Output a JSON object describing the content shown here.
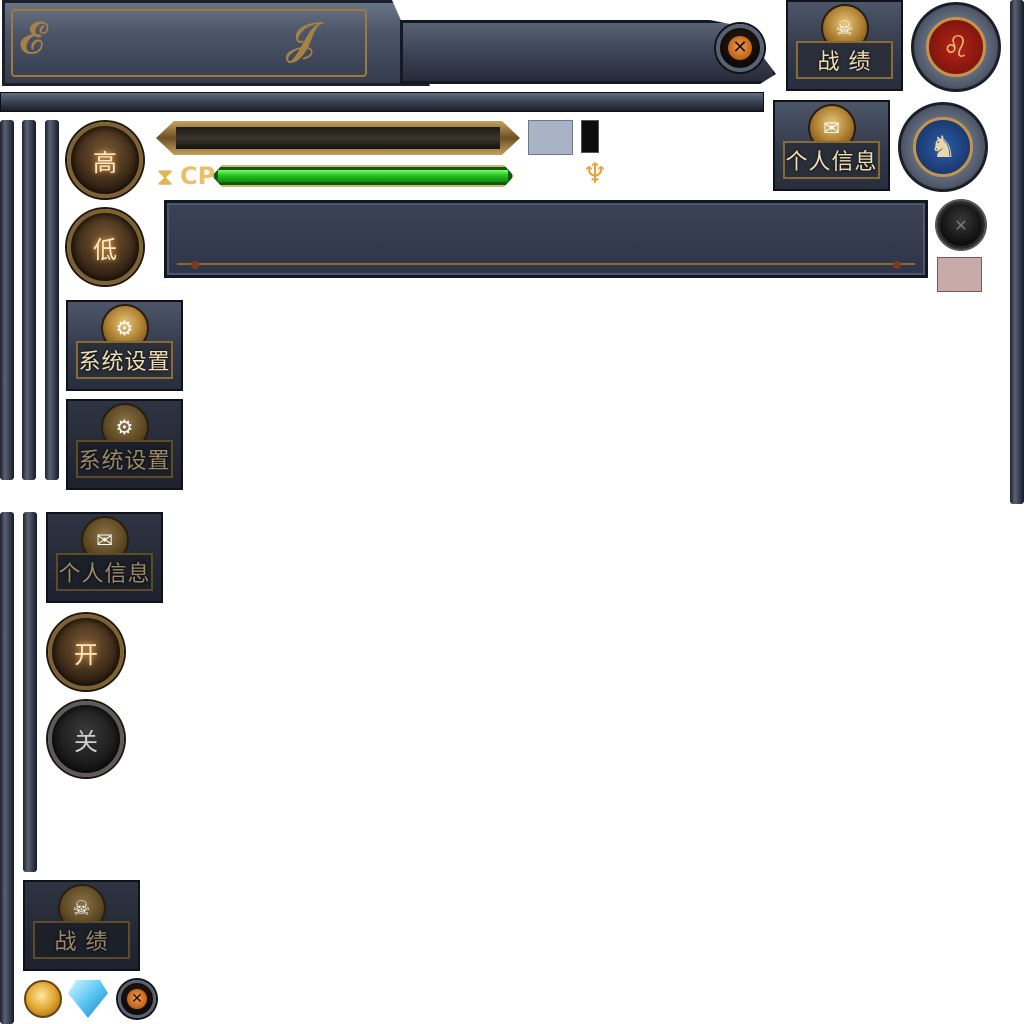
{
  "buttons": {
    "battle_record": "战 绩",
    "profile": "个人信息",
    "system_settings": "系统设置",
    "high": "高",
    "low": "低",
    "on": "开",
    "off": "关"
  },
  "bar": {
    "cp_label": "CP",
    "cp_fill_fraction": 1.0
  },
  "swatches": {
    "blue_grey": "#a9b3c6",
    "black": "#0d0d0d",
    "rose": "#c8aaa8"
  },
  "icons": {
    "close": "close-icon",
    "hourglass": "hourglass-icon",
    "trophy": "trophy-icon",
    "lion": "lion-emblem-icon",
    "dragon": "dragon-emblem-icon",
    "coin": "gold-coin-icon",
    "diamond": "diamond-icon",
    "skull": "skull-icon",
    "scroll": "scroll-icon",
    "gear": "gear-icon"
  },
  "colors": {
    "gold": "#c49448",
    "cp_green": "#27c321",
    "stone": "#3c4558"
  }
}
